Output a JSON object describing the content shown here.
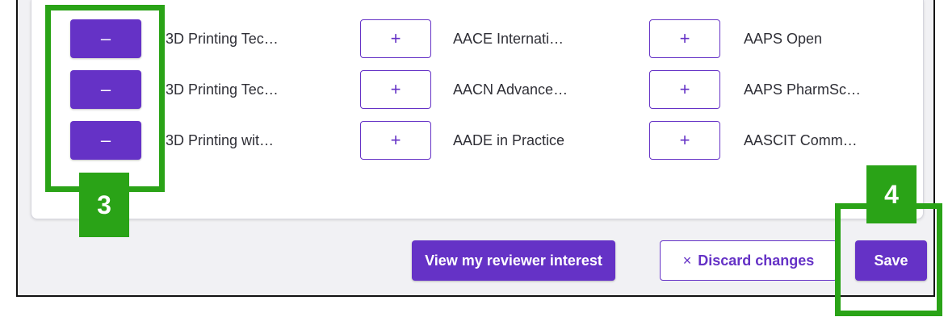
{
  "journals": {
    "col1": [
      {
        "label": "3D Printing Tec…",
        "action": "–"
      },
      {
        "label": "3D Printing Tec…",
        "action": "–"
      },
      {
        "label": "3D Printing wit…",
        "action": "–"
      }
    ],
    "col2": [
      {
        "label": "AACE Internati…",
        "action": "+"
      },
      {
        "label": "AACN Advance…",
        "action": "+"
      },
      {
        "label": "AADE in Practice",
        "action": "+"
      }
    ],
    "col3": [
      {
        "label": "AAPS Open",
        "action": "+"
      },
      {
        "label": "AAPS PharmSc…",
        "action": "+"
      },
      {
        "label": "AASCIT Comm…",
        "action": "+"
      }
    ]
  },
  "footer": {
    "view_interest_label": "View my reviewer interest",
    "discard_icon": "×",
    "discard_label": "Discard changes",
    "save_label": "Save"
  },
  "callouts": {
    "step3": "3",
    "step4": "4"
  },
  "colors": {
    "accent": "#6532c6",
    "callout": "#2aa317"
  }
}
